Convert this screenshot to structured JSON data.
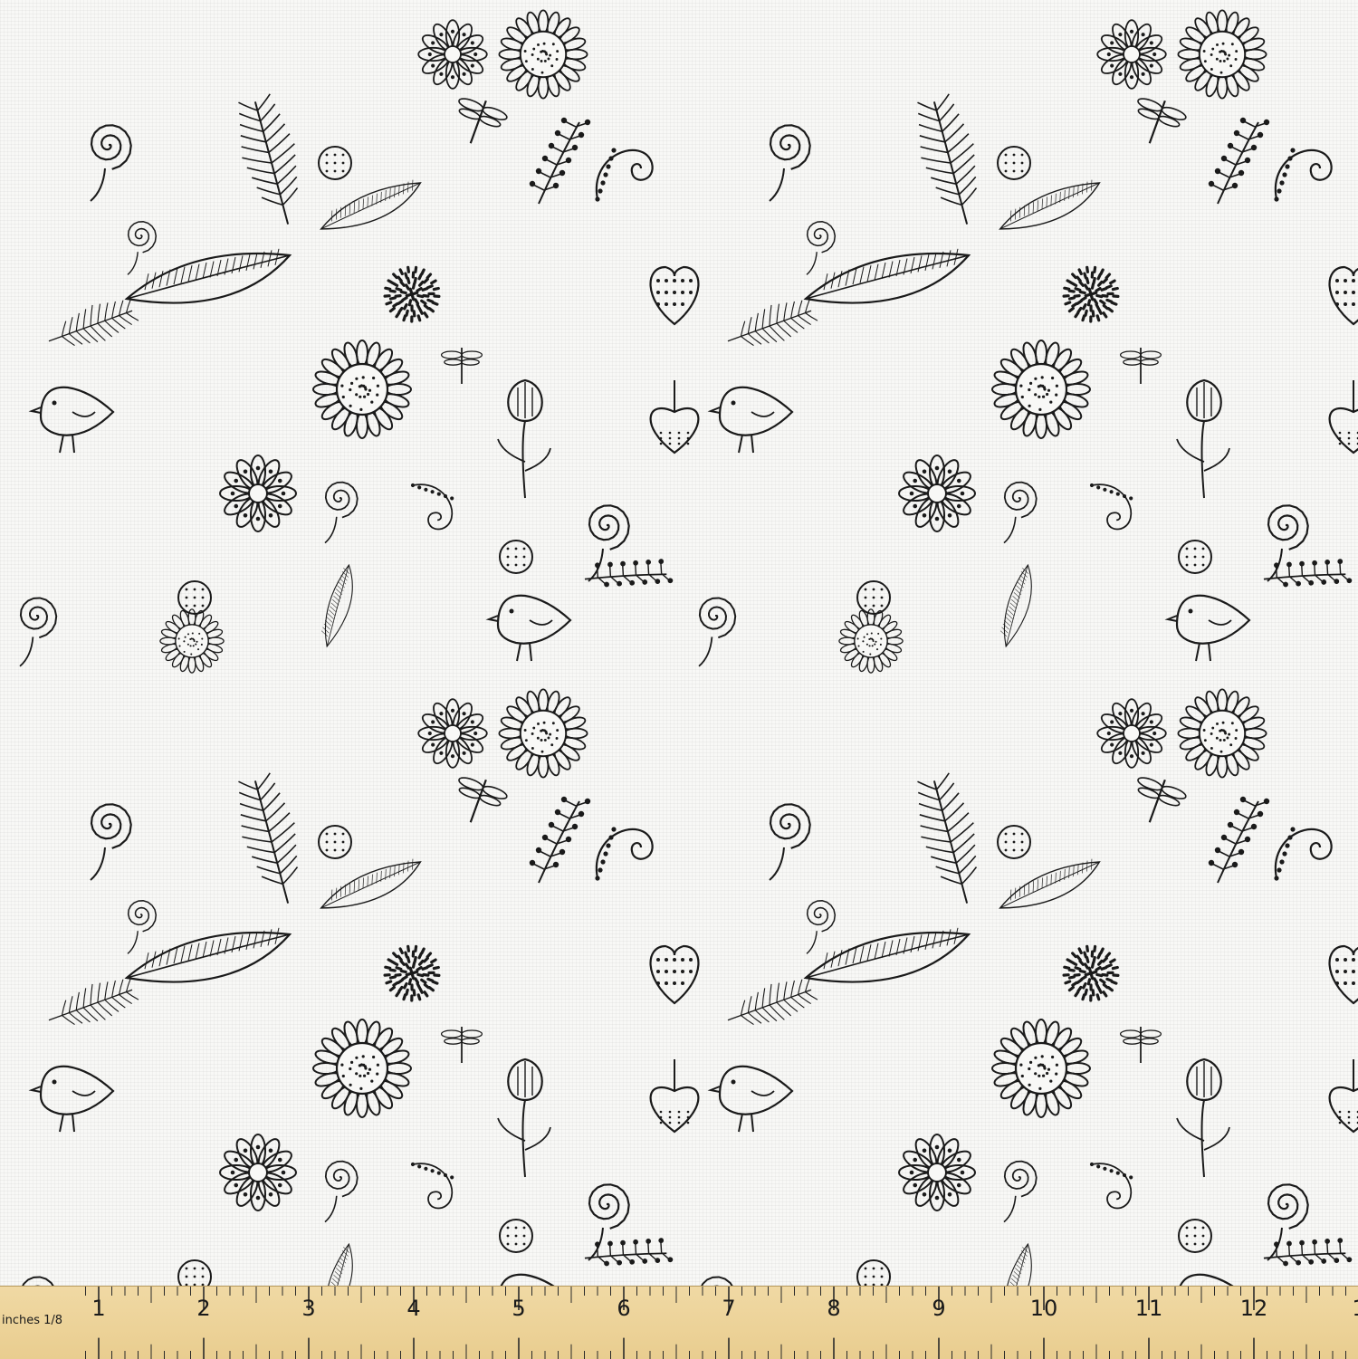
{
  "pattern": {
    "ink_color": "#1a1a1a",
    "background_color": "#f8f8f6",
    "motifs": [
      "flower-icon",
      "spiral-rose-icon",
      "leaf-icon",
      "fern-icon",
      "bird-icon",
      "heart-icon",
      "strawberry-icon",
      "dragonfly-icon",
      "sunflower-icon",
      "dotted-circle-icon",
      "berry-sprig-icon",
      "swirl-icon"
    ]
  },
  "ruler": {
    "unit_label": "inches 1/8",
    "numbers": [
      "1",
      "2",
      "3",
      "4",
      "5",
      "6",
      "7",
      "8",
      "9",
      "10",
      "11",
      "12",
      "1"
    ],
    "color": "#efd69e"
  }
}
